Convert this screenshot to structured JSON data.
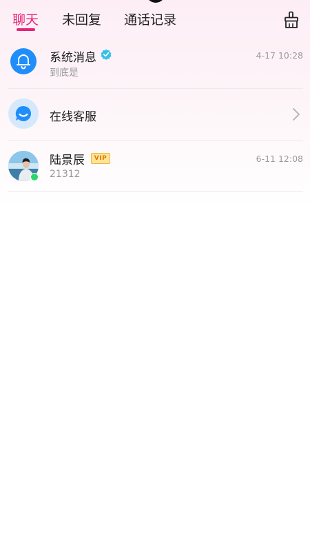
{
  "tabs": [
    {
      "label": "聊天",
      "active": true
    },
    {
      "label": "未回复",
      "active": false
    },
    {
      "label": "通话记录",
      "active": false
    }
  ],
  "toolbar": {
    "clean_icon": "broom-clean-icon"
  },
  "accent_color": "#e5247a",
  "conversations": [
    {
      "name": "系统消息",
      "preview": "到底是",
      "time": "4-17 10:28",
      "verified": true,
      "icon": "bell-icon"
    },
    {
      "name": "在线客服",
      "icon": "chat-bubble-icon",
      "chevron": "chevron-right-icon"
    },
    {
      "name": "陆景辰",
      "preview": "21312",
      "time": "6-11 12:08",
      "badge": "VIP",
      "online": true
    }
  ]
}
